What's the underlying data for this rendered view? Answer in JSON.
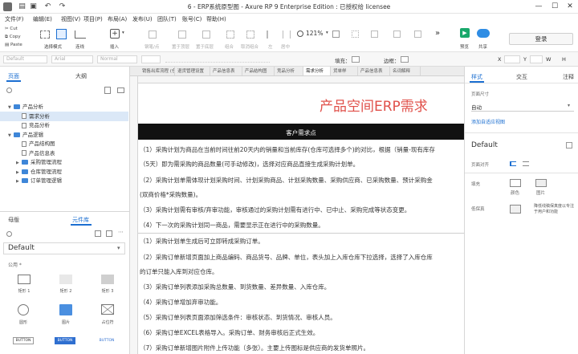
{
  "window": {
    "title": "6 - ERP系统原型图 - Axure RP 9 Enterprise Edition : 已授权给 licensee",
    "controls": [
      "—",
      "☐",
      "✕"
    ]
  },
  "menu": [
    "文件(F)",
    "编辑(E)",
    "视图(V)",
    "项目(P)",
    "布局(A)",
    "发布(U)",
    "团队(T)",
    "账号(C)",
    "帮助(H)"
  ],
  "clipboard": {
    "cut": "Cut",
    "copy": "Copy",
    "paste": "Paste"
  },
  "toolbar": {
    "select_mode": "选择模式",
    "connect": "连线",
    "insert": "插入",
    "point": "钢笔/点",
    "top": "置于顶层",
    "bottom": "置于底层",
    "group": "组合",
    "ungroup": "取消组合",
    "left": "左",
    "center": "居中",
    "right": "右",
    "zoom": "121%",
    "preview": "预览",
    "share": "共享",
    "login": "登录"
  },
  "stylebar": {
    "style": "Default",
    "font": "Arial",
    "weight": "Normal",
    "fill_label": "填充：",
    "border_label": "边框：",
    "x": "X",
    "y": "Y",
    "w": "W",
    "h": "H"
  },
  "left_panel": {
    "tabs": [
      "页面",
      "大纲"
    ],
    "tree": [
      {
        "label": "产品分析",
        "type": "folder",
        "indent": 0,
        "open": true
      },
      {
        "label": "需求分析",
        "type": "page",
        "indent": 1,
        "selected": true
      },
      {
        "label": "竞品分析",
        "type": "page",
        "indent": 1
      },
      {
        "label": "产品逻辑",
        "type": "folder",
        "indent": 0,
        "open": true
      },
      {
        "label": "产品结构图",
        "type": "page",
        "indent": 1
      },
      {
        "label": "产品信息表",
        "type": "page",
        "indent": 1
      },
      {
        "label": "采购管理流程",
        "type": "folder",
        "indent": 1
      },
      {
        "label": "仓库管理流程",
        "type": "folder",
        "indent": 1
      },
      {
        "label": "订单管理逻辑",
        "type": "folder",
        "indent": 1
      }
    ],
    "lib_tabs": [
      "母版",
      "元件库"
    ],
    "library": "Default",
    "section": "公用 *",
    "widgets": [
      "矩形 1",
      "矩形 2",
      "矩形 3",
      "圆形",
      "图片",
      "占位符",
      "BUTTON",
      "BUTTON",
      "BUTTON"
    ]
  },
  "page_tabs": [
    "销售出库流程 (仓",
    "退货管理设置",
    "产品信息表",
    "产品结构图",
    "竞品分析",
    "需求分析",
    "货单样",
    "产品信息表",
    "名词解释"
  ],
  "canvas": {
    "heading": "产品空间ERP需求",
    "banner": "客户需求点",
    "requirements": [
      "（1）采购计划为商品在当前时间往前20天内的销量和当前库存(仓库可选择多个)的对比，根据（销量-现有库存",
      "（5天）即为需采购的商品数量(可手动修改)，选择对应商品直接生成采购计划单。",
      "（2）采购计划单需体现计划采购时间、计划采购商品、计划采购数量、采购供应商、已采购数量、预计采购金",
      "(双商价格*采购数量)。",
      "（3）采购计划需有审核/弃审功能，审核通过的采购计划需有进行中、已中止、采购完成等状态变更。",
      "（4）下一次的采购计划同一商品，需要显示正在进行中的采购数量。",
      "（1）采购计划单生成后可立即转成采购订单。",
      "（2）采购订单新增页面加上商品编码、商品货号、品牌、单位，表头加上入库仓库下拉选择，选择了入库仓库",
      "的订单只能入库到对应仓库。",
      "（3）采购订单列表添加采购总数量、到货数量、差异数量、入库仓库。",
      "（4）采购订单增加弃审功能。",
      "（5）采购订单列表页面添加筛选条件：审核状态、到货情况、审核人员。",
      "（6）采购订单EXCEL表格导入。采购订单、财务审核后正式生效。",
      "（7）采购订单新增图片附件上传功能（多张）。主要上传图标是供应商的发货单照片。"
    ]
  },
  "right_panel": {
    "tabs": [
      "样式",
      "交互",
      "注释"
    ],
    "page_size_label": "页面尺寸",
    "page_size": "自动",
    "adaptive_link": "添加自适应视图",
    "style_name": "Default",
    "align_label": "页面对齐",
    "fill_label": "填充",
    "fill_color": "颜色",
    "fill_image": "图片",
    "low_fidelity_label": "低保真",
    "low_fidelity_text": "降低线稿保真度以专注于用户和功能"
  },
  "colors": {
    "accent": "#1c6fd1",
    "heading_red": "#e0504a",
    "banner_black": "#111111",
    "preview_green": "#19a86b",
    "share_blue": "#2f8de4"
  }
}
